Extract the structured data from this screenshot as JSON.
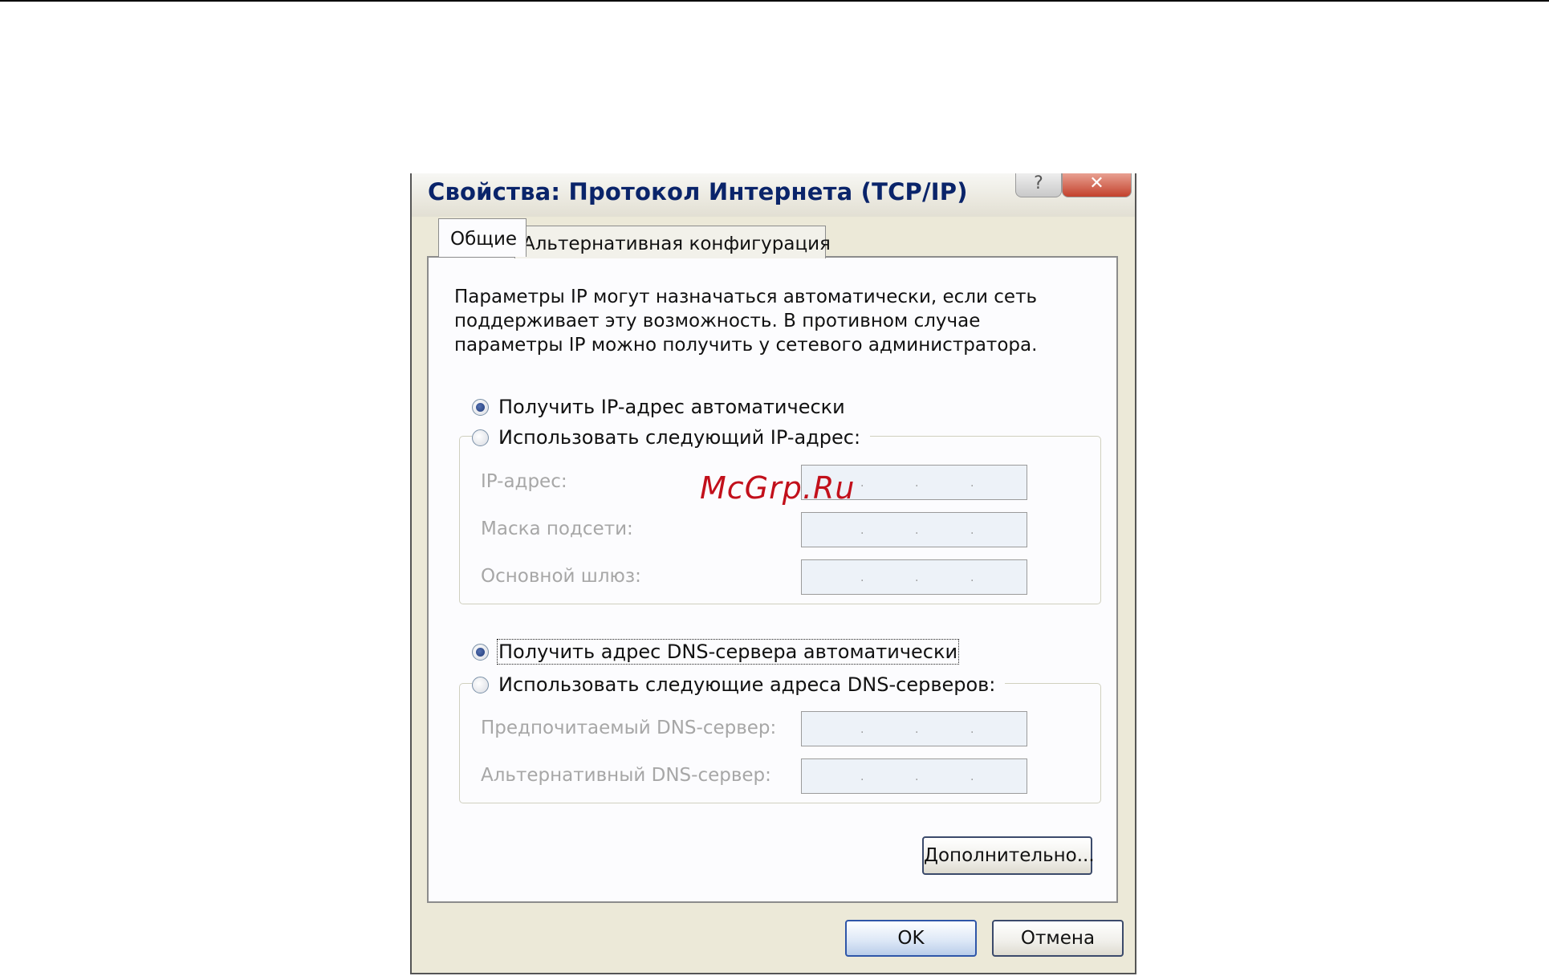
{
  "window": {
    "title": "Свойства: Протокол Интернета (TCP/IP)",
    "help_label": "?",
    "close_label": "✕"
  },
  "tabs": [
    {
      "label": "Общие",
      "selected": true
    },
    {
      "label": "Альтернативная конфигурация",
      "selected": false
    }
  ],
  "general": {
    "description": "Параметры IP могут назначаться автоматически, если сеть поддерживает эту возможность. В противном случае параметры IP можно получить у сетевого администратора.",
    "ip_auto": {
      "label": "Получить IP-адрес автоматически",
      "checked": true
    },
    "ip_manual": {
      "label": "Использовать следующий IP-адрес:",
      "checked": false
    },
    "ip_fields": [
      {
        "label": "IP-адрес:",
        "value": ". . ."
      },
      {
        "label": "Маска подсети:",
        "value": ". . ."
      },
      {
        "label": "Основной шлюз:",
        "value": ". . ."
      }
    ],
    "dns_auto": {
      "label": "Получить адрес DNS-сервера автоматически",
      "checked": true
    },
    "dns_manual": {
      "label": "Использовать следующие адреса DNS-серверов:",
      "checked": false
    },
    "dns_fields": [
      {
        "label": "Предпочитаемый DNS-сервер:",
        "value": ". . ."
      },
      {
        "label": "Альтернативный DNS-сервер:",
        "value": ". . ."
      }
    ],
    "advanced_label": "Дополнительно..."
  },
  "footer": {
    "ok_label": "OK",
    "cancel_label": "Отмена"
  },
  "watermark": "McGrp.Ru",
  "colors": {
    "dialog_bg": "#ECE9D8",
    "title_text": "#0a246a",
    "disabled_text": "#a7a7a7",
    "watermark": "#c2101b"
  }
}
